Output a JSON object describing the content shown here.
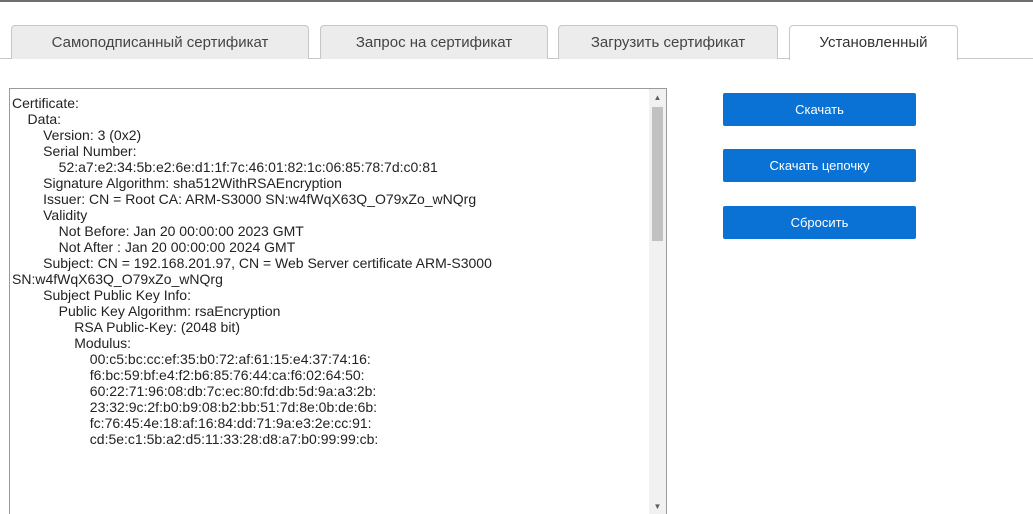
{
  "tabs": [
    {
      "label": "Самоподписанный сертификат",
      "active": false
    },
    {
      "label": "Запрос на сертификат",
      "active": false
    },
    {
      "label": "Загрузить сертификат",
      "active": false
    },
    {
      "label": "Установленный",
      "active": true
    }
  ],
  "certificate": {
    "lines": [
      "Certificate:",
      "    Data:",
      "        Version: 3 (0x2)",
      "        Serial Number:",
      "            52:a7:e2:34:5b:e2:6e:d1:1f:7c:46:01:82:1c:06:85:78:7d:c0:81",
      "        Signature Algorithm: sha512WithRSAEncryption",
      "        Issuer: CN = Root CA: ARM-S3000 SN:w4fWqX63Q_O79xZo_wNQrg",
      "        Validity",
      "            Not Before: Jan 20 00:00:00 2023 GMT",
      "            Not After : Jan 20 00:00:00 2024 GMT",
      "        Subject: CN = 192.168.201.97, CN = Web Server certificate ARM-S3000",
      "SN:w4fWqX63Q_O79xZo_wNQrg",
      "        Subject Public Key Info:",
      "            Public Key Algorithm: rsaEncryption",
      "                RSA Public-Key: (2048 bit)",
      "                Modulus:",
      "                    00:c5:bc:cc:ef:35:b0:72:af:61:15:e4:37:74:16:",
      "                    f6:bc:59:bf:e4:f2:b6:85:76:44:ca:f6:02:64:50:",
      "                    60:22:71:96:08:db:7c:ec:80:fd:db:5d:9a:a3:2b:",
      "                    23:32:9c:2f:b0:b9:08:b2:bb:51:7d:8e:0b:de:6b:",
      "                    fc:76:45:4e:18:af:16:84:dd:71:9a:e3:2e:cc:91:",
      "                    cd:5e:c1:5b:a2:d5:11:33:28:d8:a7:b0:99:99:cb:"
    ]
  },
  "buttons": {
    "download": "Скачать",
    "download_chain": "Скачать цепочку",
    "reset": "Сбросить"
  },
  "colors": {
    "primary_button": "#0a72d4",
    "tab_inactive_bg": "#ececec"
  }
}
